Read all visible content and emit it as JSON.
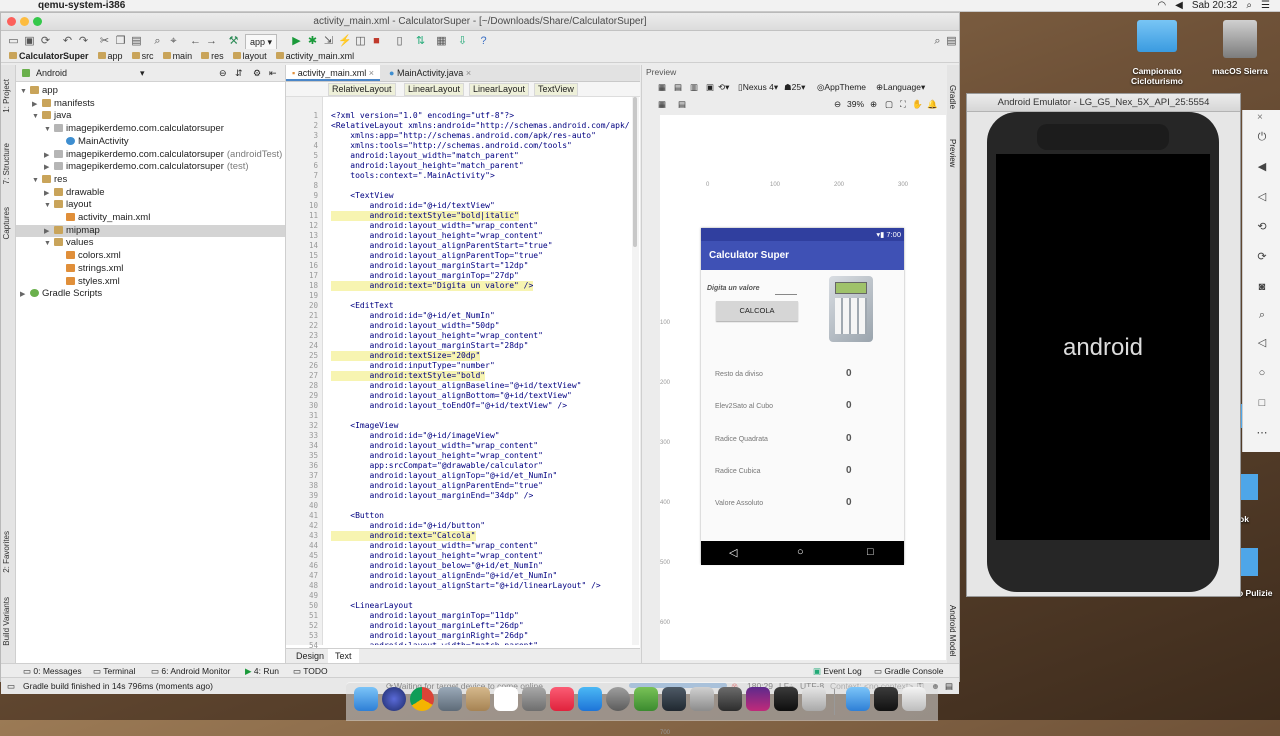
{
  "menubar": {
    "app_name": "qemu-system-i386",
    "clock": "Sab 20:32"
  },
  "ide": {
    "title": "activity_main.xml - CalculatorSuper - [~/Downloads/Share/CalculatorSuper]",
    "run_config": "app",
    "breadcrumb": [
      "CalculatorSuper",
      "app",
      "src",
      "main",
      "res",
      "layout",
      "activity_main.xml"
    ],
    "project_view": "Android",
    "tree": [
      {
        "label": "app",
        "indent": 0,
        "icon": "fold",
        "arrow": "▼"
      },
      {
        "label": "manifests",
        "indent": 1,
        "icon": "fold",
        "arrow": "▶"
      },
      {
        "label": "java",
        "indent": 1,
        "icon": "fold",
        "arrow": "▼"
      },
      {
        "label": "imagepikerdemo.com.calculatorsuper",
        "indent": 2,
        "icon": "pkg",
        "arrow": "▼"
      },
      {
        "label": "MainActivity",
        "indent": 3,
        "icon": "cls",
        "arrow": ""
      },
      {
        "label": "imagepikerdemo.com.calculatorsuper",
        "suffix": "(androidTest)",
        "indent": 2,
        "icon": "pkg",
        "arrow": "▶"
      },
      {
        "label": "imagepikerdemo.com.calculatorsuper",
        "suffix": "(test)",
        "indent": 2,
        "icon": "pkg",
        "arrow": "▶"
      },
      {
        "label": "res",
        "indent": 1,
        "icon": "fold",
        "arrow": "▼"
      },
      {
        "label": "drawable",
        "indent": 2,
        "icon": "fold",
        "arrow": "▶"
      },
      {
        "label": "layout",
        "indent": 2,
        "icon": "fold",
        "arrow": "▼"
      },
      {
        "label": "activity_main.xml",
        "indent": 3,
        "icon": "xmlic",
        "arrow": ""
      },
      {
        "label": "mipmap",
        "indent": 2,
        "icon": "fold",
        "arrow": "▶",
        "selected": true
      },
      {
        "label": "values",
        "indent": 2,
        "icon": "fold",
        "arrow": "▼"
      },
      {
        "label": "colors.xml",
        "indent": 3,
        "icon": "xmlic",
        "arrow": ""
      },
      {
        "label": "strings.xml",
        "indent": 3,
        "icon": "xmlic",
        "arrow": ""
      },
      {
        "label": "styles.xml",
        "indent": 3,
        "icon": "xmlic",
        "arrow": ""
      },
      {
        "label": "Gradle Scripts",
        "indent": 0,
        "icon": "grad",
        "arrow": "▶"
      }
    ],
    "left_strip": [
      "1: Project",
      "7: Structure",
      "Captures",
      "2: Favorites",
      "Build Variants"
    ],
    "right_strip": [
      "Gradle",
      "Preview",
      "Android Model"
    ],
    "editor_tabs": [
      "activity_main.xml",
      "MainActivity.java"
    ],
    "xml_path": [
      "RelativeLayout",
      "LinearLayout",
      "LinearLayout",
      "TextView"
    ],
    "code_lines": [
      "<?xml version=\"1.0\" encoding=\"utf-8\"?>",
      "<RelativeLayout xmlns:android=\"http://schemas.android.com/apk/res/",
      "    xmlns:app=\"http://schemas.android.com/apk/res-auto\"",
      "    xmlns:tools=\"http://schemas.android.com/tools\"",
      "    android:layout_width=\"match_parent\"",
      "    android:layout_height=\"match_parent\"",
      "    tools:context=\".MainActivity\">",
      "",
      "    <TextView",
      "        android:id=\"@+id/textView\"",
      "        android:textStyle=\"bold|italic\"",
      "        android:layout_width=\"wrap_content\"",
      "        android:layout_height=\"wrap_content\"",
      "        android:layout_alignParentStart=\"true\"",
      "        android:layout_alignParentTop=\"true\"",
      "        android:layout_marginStart=\"12dp\"",
      "        android:layout_marginTop=\"27dp\"",
      "        android:text=\"Digita un valore\" />",
      "",
      "    <EditText",
      "        android:id=\"@+id/et_NumIn\"",
      "        android:layout_width=\"50dp\"",
      "        android:layout_height=\"wrap_content\"",
      "        android:layout_marginStart=\"28dp\"",
      "        android:textSize=\"20dp\"",
      "        android:inputType=\"number\"",
      "        android:textStyle=\"bold\"",
      "        android:layout_alignBaseline=\"@+id/textView\"",
      "        android:layout_alignBottom=\"@+id/textView\"",
      "        android:layout_toEndOf=\"@+id/textView\" />",
      "",
      "    <ImageView",
      "        android:id=\"@+id/imageView\"",
      "        android:layout_width=\"wrap_content\"",
      "        android:layout_height=\"wrap_content\"",
      "        app:srcCompat=\"@drawable/calculator\"",
      "        android:layout_alignTop=\"@+id/et_NumIn\"",
      "        android:layout_alignParentEnd=\"true\"",
      "        android:layout_marginEnd=\"34dp\" />",
      "",
      "    <Button",
      "        android:id=\"@+id/button\"",
      "        android:text=\"Calcola\"",
      "        android:layout_width=\"wrap_content\"",
      "        android:layout_height=\"wrap_content\"",
      "        android:layout_below=\"@+id/et_NumIn\"",
      "        android:layout_alignEnd=\"@+id/et_NumIn\"",
      "        android:layout_alignStart=\"@+id/linearLayout\" />",
      "",
      "    <LinearLayout",
      "        android:layout_marginTop=\"11dp\"",
      "        android:layout_marginLeft=\"26dp\"",
      "        android:layout_marginRight=\"26dp\"",
      "        android:layout_width=\"match_parent\""
    ],
    "bottom_tabs": [
      "Design",
      "Text"
    ],
    "preview": {
      "title": "Preview",
      "device": "Nexus 4",
      "api": "25",
      "theme": "AppTheme",
      "language": "Language",
      "zoom": "39%",
      "ruler": [
        "0",
        "100",
        "200",
        "300"
      ],
      "vruler": [
        "100",
        "200",
        "300",
        "400",
        "500",
        "600",
        "700"
      ],
      "app_title": "Calculator Super",
      "time": "7:00",
      "input_label": "Digita un valore",
      "button": "CALCOLA",
      "rows": [
        {
          "label": "Resto da diviso",
          "value": "0"
        },
        {
          "label": "Elev2Sato al Cubo",
          "value": "0"
        },
        {
          "label": "Radice Quadrata",
          "value": "0"
        },
        {
          "label": "Radice Cubica",
          "value": "0"
        },
        {
          "label": "Valore Assoluto",
          "value": "0"
        }
      ]
    },
    "tool_tabs": [
      "0: Messages",
      "Terminal",
      "6: Android Monitor",
      "4: Run",
      "TODO",
      "Event Log",
      "Gradle Console"
    ],
    "status": {
      "left": "Gradle build finished in 14s 796ms (moments ago)",
      "center": "Waiting for target device to come online",
      "pos": "180:29",
      "lf": "LF÷",
      "enc": "UTF-8",
      "ctx": "Context: <no context>"
    }
  },
  "desktop": {
    "icons": [
      {
        "label": "Campionato Cicloturismo"
      },
      {
        "label": "macOS Sierra"
      }
    ],
    "partial": [
      "ok",
      "o Pulizie"
    ]
  },
  "emulator": {
    "title": "Android Emulator - LG_G5_Nex_5X_API_25:5554",
    "boot_text": "android"
  }
}
